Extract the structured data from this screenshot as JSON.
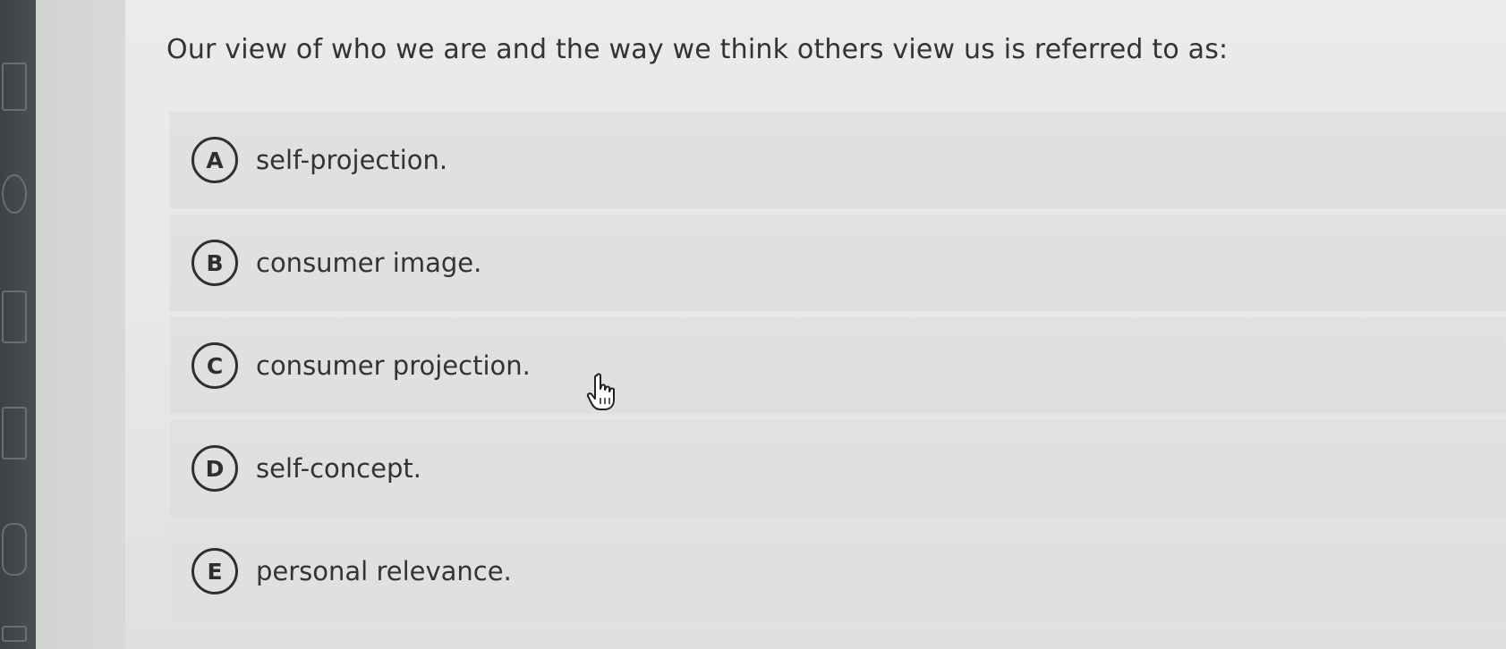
{
  "question": {
    "text": "Our view of who we are and the way we think others view us is referred to as:"
  },
  "options": [
    {
      "letter": "A",
      "text": "self-projection."
    },
    {
      "letter": "B",
      "text": "consumer image."
    },
    {
      "letter": "C",
      "text": "consumer projection."
    },
    {
      "letter": "D",
      "text": "self-concept."
    },
    {
      "letter": "E",
      "text": "personal relevance."
    }
  ],
  "cursor": {
    "icon": "hand-pointer-icon"
  }
}
